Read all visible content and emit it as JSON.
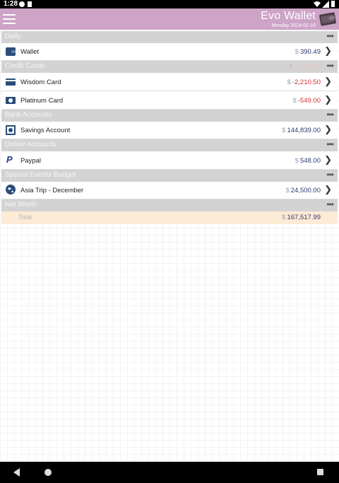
{
  "status_bar": {
    "time": "1:28"
  },
  "app_bar": {
    "title": "Evo Wallet",
    "date": "Monday 2024-02-19"
  },
  "currency_symbol": "$",
  "sections": {
    "daily": {
      "label": "Daily",
      "items": [
        {
          "label": "Wallet",
          "amount": "390.49",
          "icon": "wallet-icon"
        }
      ]
    },
    "credit_cards": {
      "label": "Credit Cards",
      "sum": "-2,759.50",
      "items": [
        {
          "label": "Wisdom Card",
          "amount": "-2,210.50",
          "icon": "credit-card-icon"
        },
        {
          "label": "Platinum Card",
          "amount": "-549.00",
          "icon": "money-card-icon"
        }
      ]
    },
    "bank_accounts": {
      "label": "Bank Accounts",
      "items": [
        {
          "label": "Savings Account",
          "amount": "144,839.00",
          "icon": "safe-icon"
        }
      ]
    },
    "online_accounts": {
      "label": "Online Accounts",
      "items": [
        {
          "label": "Paypal",
          "amount": "548.00",
          "icon": "paypal-icon"
        }
      ]
    },
    "special_events": {
      "label": "Special Events Budget",
      "items": [
        {
          "label": "Asia Trip - December",
          "amount": "24,500.00",
          "icon": "globe-icon"
        }
      ]
    },
    "net_worth": {
      "label": "Net Worth",
      "total_label": "Total",
      "total_amount": "167,517.99"
    }
  },
  "colors": {
    "app_bar": "#cda3c7",
    "positive": "#2b3a72",
    "negative": "#d32f2f",
    "total_bg": "#fdebd6"
  }
}
